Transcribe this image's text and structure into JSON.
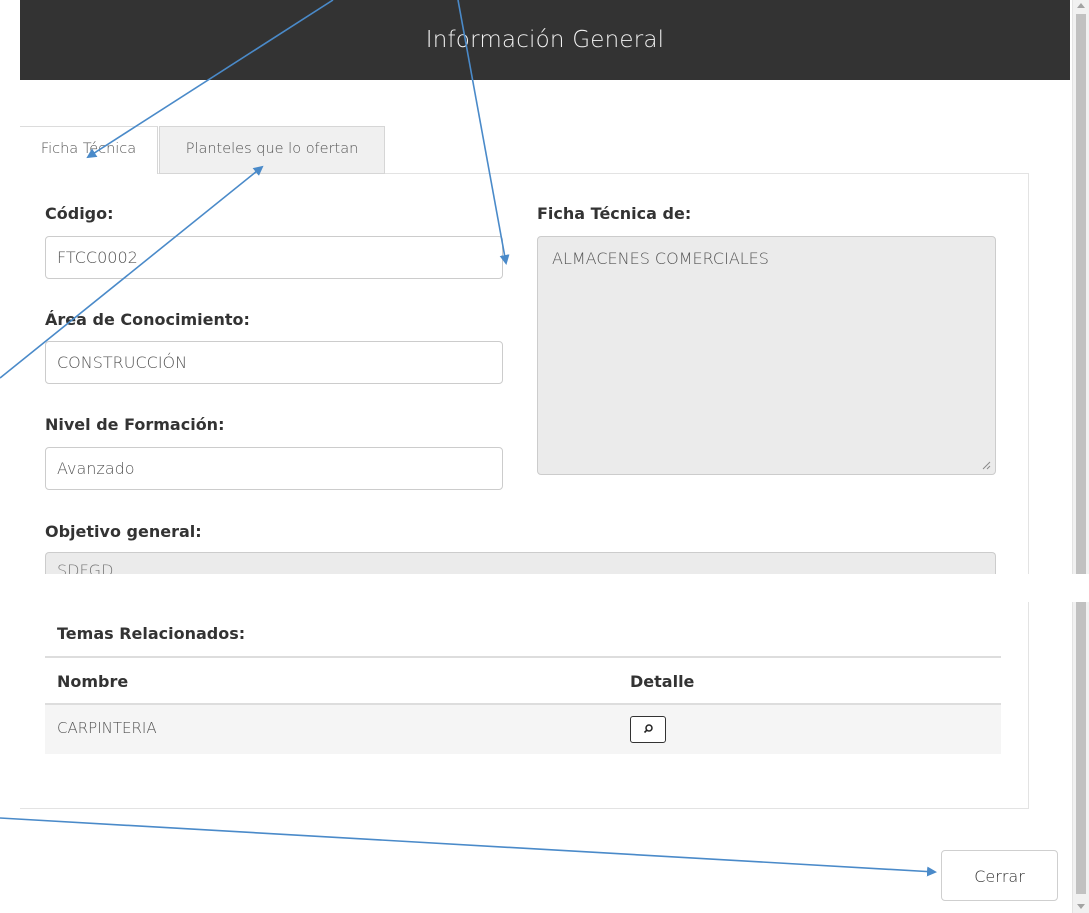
{
  "modal": {
    "title": "Información General"
  },
  "tabs": [
    {
      "label": "Ficha Técnica",
      "active": true
    },
    {
      "label": "Planteles que lo ofertan",
      "active": false
    }
  ],
  "form": {
    "codigo_label": "Código:",
    "codigo_value": "FTCC0002",
    "area_label": "Área de Conocimiento:",
    "area_value": "CONSTRUCCIÓN",
    "nivel_label": "Nivel de Formación:",
    "nivel_value": "Avanzado",
    "ficha_de_label": "Ficha Técnica de:",
    "ficha_de_value": "ALMACENES COMERCIALES",
    "objetivo_label": "Objetivo general:",
    "objetivo_value": "SDFGD"
  },
  "temas": {
    "title": "Temas Relacionados:",
    "columns": [
      "Nombre",
      "Detalle"
    ],
    "rows": [
      {
        "nombre": "CARPINTERIA",
        "detalle_icon": "search-icon"
      }
    ]
  },
  "footer": {
    "close_label": "Cerrar"
  },
  "colors": {
    "header_bg": "#333333",
    "annotation_arrow": "#4a8ac9",
    "readonly_bg": "#ebebeb"
  }
}
